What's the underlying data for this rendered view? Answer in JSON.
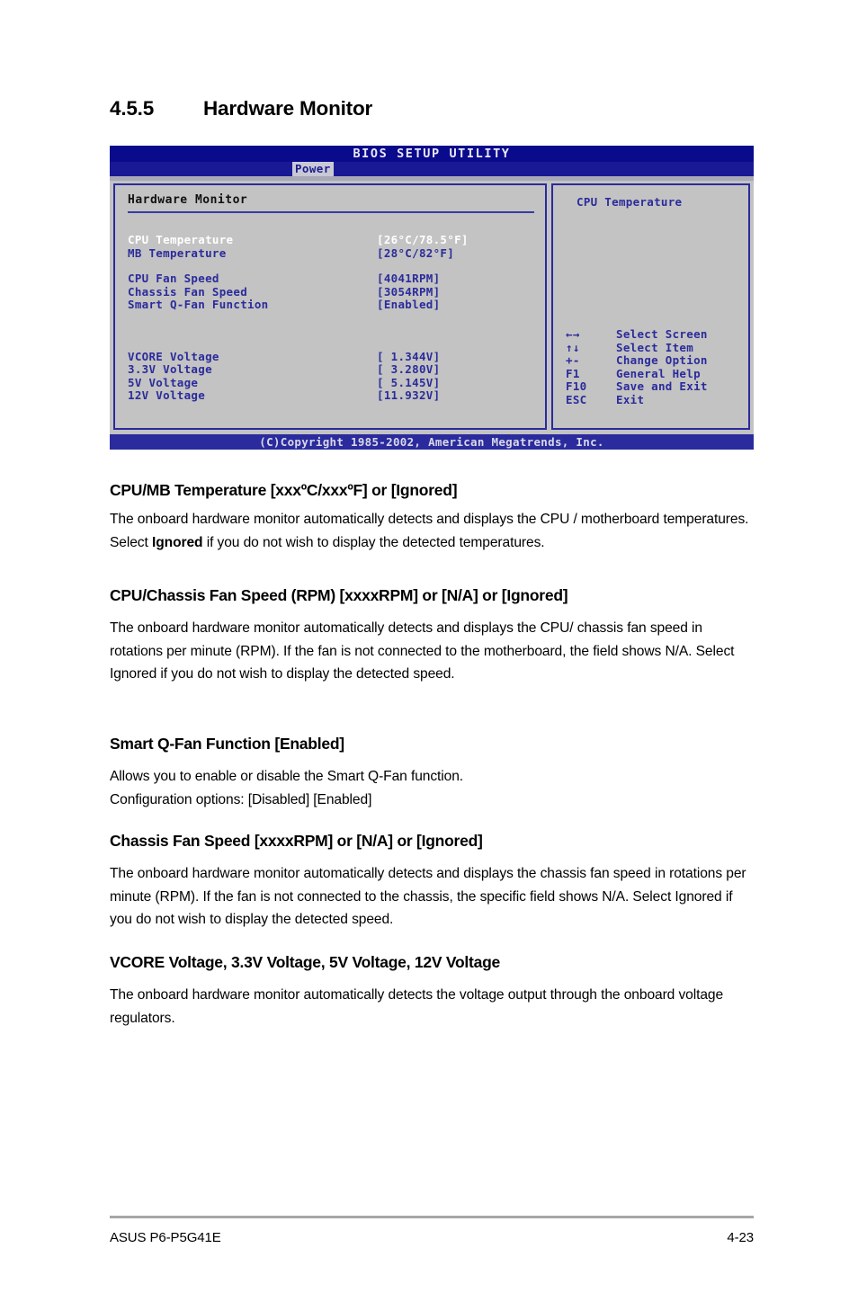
{
  "heading": {
    "number": "4.5.5",
    "title": "Hardware Monitor"
  },
  "bios": {
    "window_title": "BIOS SETUP UTILITY",
    "active_tab": "Power",
    "panel_title": "Hardware Monitor",
    "items": [
      {
        "label": "CPU Temperature",
        "value": "[26°C/78.5°F]",
        "selected": true
      },
      {
        "label": "MB Temperature",
        "value": "[28°C/82°F]",
        "selected": false
      },
      {
        "label": "CPU Fan Speed",
        "value": "[4041RPM]",
        "selected": false
      },
      {
        "label": "Chassis Fan Speed",
        "value": "[3054RPM]",
        "selected": false
      },
      {
        "label": "Smart Q-Fan Function",
        "value": "[Enabled]",
        "selected": false
      },
      {
        "label": "VCORE Voltage",
        "value": "[ 1.344V]",
        "selected": false
      },
      {
        "label": "3.3V Voltage",
        "value": "[ 3.280V]",
        "selected": false
      },
      {
        "label": "5V Voltage",
        "value": "[ 5.145V]",
        "selected": false
      },
      {
        "label": "12V Voltage",
        "value": "[11.932V]",
        "selected": false
      }
    ],
    "help_title": "CPU Temperature",
    "keys": [
      {
        "key": "←→",
        "desc": "Select Screen"
      },
      {
        "key": "↑↓",
        "desc": "Select Item"
      },
      {
        "key": "+-",
        "desc": "Change Option"
      },
      {
        "key": "F1",
        "desc": "General Help"
      },
      {
        "key": "F10",
        "desc": "Save and Exit"
      },
      {
        "key": "ESC",
        "desc": "Exit"
      }
    ],
    "copyright": "(C)Copyright 1985-2002, American Megatrends, Inc.",
    "colors": {
      "titlebar": "#0a0a8c",
      "tabbar": "#191995",
      "panel_bg": "#c3c3c3",
      "text_blue": "#2b2b9c",
      "selected_text": "#ffffff",
      "border": "#2a2a9e",
      "footer_bar": "#2b2b9e"
    }
  },
  "sections": [
    {
      "title": "CPU/MB Temperature [xxxºC/xxxºF] or [Ignored]",
      "body_pre": "The onboard hardware monitor automatically detects and displays the CPU / motherboard temperatures. Select ",
      "body_bold": "Ignored",
      "body_post": " if you do not wish to display the detected temperatures."
    },
    {
      "title": "CPU/Chassis Fan Speed (RPM) [xxxxRPM] or [N/A] or [Ignored]",
      "body": "The onboard hardware monitor automatically detects and displays the CPU/ chassis fan speed in rotations per minute (RPM). If the fan is not connected to the motherboard, the field shows N/A. Select Ignored if you do not wish to display the detected speed."
    },
    {
      "title": "Smart Q-Fan Function [Enabled]",
      "body_line1": "Allows you to enable or disable the Smart Q-Fan function.",
      "body_line2": "Configuration options: [Disabled] [Enabled]"
    },
    {
      "title": "Chassis Fan Speed [xxxxRPM] or [N/A] or [Ignored]",
      "body": "The onboard hardware monitor automatically detects and displays the chassis fan speed in rotations per minute (RPM). If the fan is not connected to the chassis, the specific field shows N/A. Select Ignored if you do not wish to display the detected speed."
    },
    {
      "title": "VCORE Voltage, 3.3V Voltage, 5V Voltage, 12V Voltage",
      "body": "The onboard hardware monitor automatically detects the voltage output through the onboard voltage regulators."
    }
  ],
  "footer": {
    "left": "ASUS P6-P5G41E",
    "right": "4-23"
  }
}
